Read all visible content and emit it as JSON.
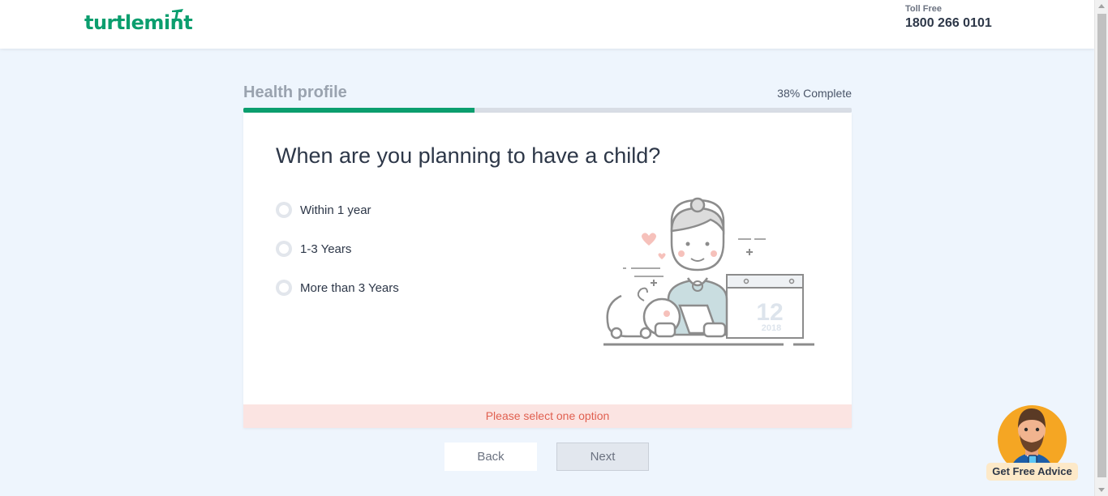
{
  "header": {
    "logo_text": "turtlemint",
    "toll_label": "Toll Free",
    "toll_number": "1800 266 0101"
  },
  "progress": {
    "section_title": "Health profile",
    "percent_text": "38% Complete",
    "fraction": 0.38
  },
  "question": {
    "title": "When are you planning to have a child?",
    "options": [
      {
        "label": "Within 1 year",
        "selected": false
      },
      {
        "label": "1-3 Years",
        "selected": false
      },
      {
        "label": "More than 3 Years",
        "selected": false
      }
    ],
    "illustration": {
      "calendar_day": "12",
      "calendar_year": "2018"
    },
    "error": "Please select one option"
  },
  "nav": {
    "back_label": "Back",
    "next_label": "Next"
  },
  "advice_widget": {
    "label": "Get Free Advice"
  },
  "colors": {
    "brand": "#0b9e6e",
    "background": "#eef5fd",
    "error_bg": "#fbe4e2",
    "error_text": "#e06050",
    "advice_bg": "#f5a623"
  }
}
